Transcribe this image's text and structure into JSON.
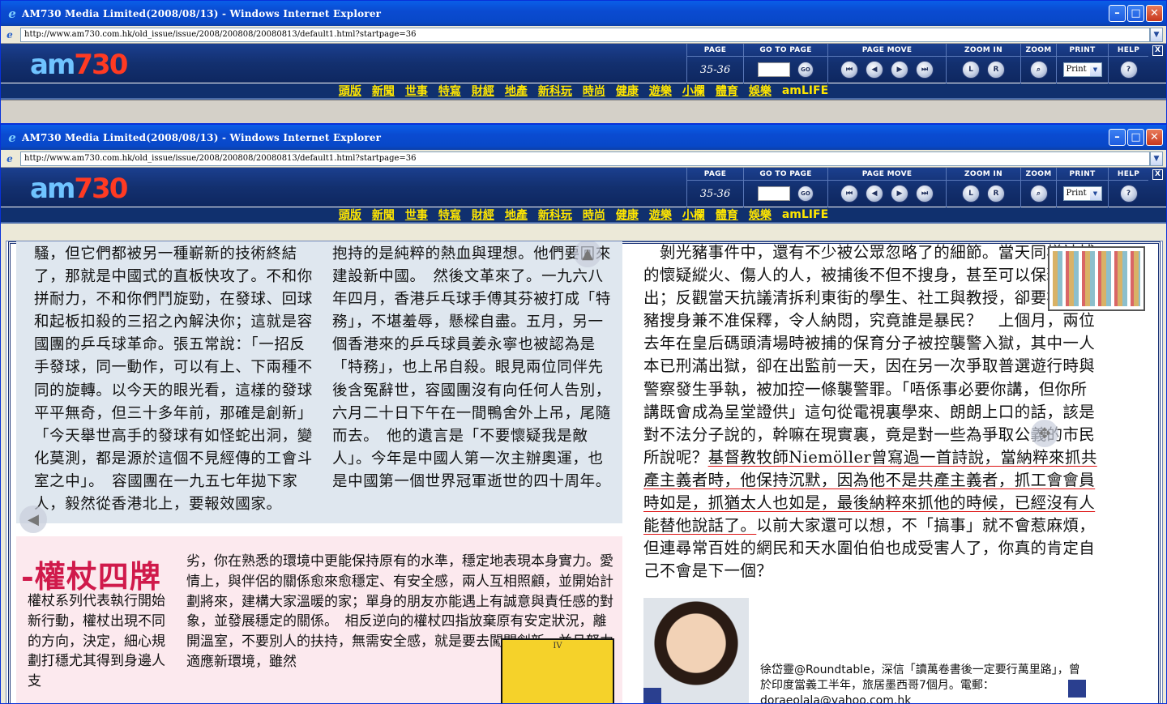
{
  "window": {
    "title": "AM730 Media Limited(2008/08/13) - Windows Internet Explorer",
    "url": "http://www.am730.com.hk/old_issue/issue/2008/200808/20080813/default1.html?startpage=36",
    "minimize": "–",
    "maximize": "□",
    "close": "✕"
  },
  "toolbar": {
    "logo_am": "am",
    "logo_num": "730",
    "page_label": "PAGE",
    "page_value": "35-36",
    "goto_label": "GO TO PAGE",
    "go_label": "GO",
    "pagemove_label": "PAGE MOVE",
    "zoomin_label": "ZOOM IN",
    "zoomin_l": "L",
    "zoomin_r": "R",
    "zoom_label": "ZOOM",
    "print_label": "PRINT",
    "print_value": "Print",
    "help_label": "HELP",
    "help_icon": "?",
    "close_x": "X"
  },
  "nav": [
    "頭版",
    "新聞",
    "世事",
    "特寫",
    "財經",
    "地產",
    "新科玩",
    "時尚",
    "健康",
    "遊樂",
    "小欄",
    "體育",
    "娛樂",
    "amLIFE"
  ],
  "article_left": {
    "col1": "騷，但它們都被另一種嶄新的技術終結了，那就是中國式的直板快攻了。不和你拼耐力，不和你們鬥旋勁，在發球、回球和起板扣殺的三招之內解決你；這就是容國團的乒乓球革命。張五常說：「一招反手發球，同一動作，可以有上、下兩種不同的旋轉。以今天的眼光看，這樣的發球平平無奇，但三十多年前，那確是創新」「今天舉世高手的發球有如怪蛇出洞，變化莫測，都是源於這個不見經傳的工會斗室之中」。　容國團在一九五七年拋下家人，毅然從香港北上，要報效國家。",
    "col2": "抱持的是純粹的熱血與理想。他們要回來建設新中國。　然後文革來了。一九六八年四月，香港乒乓球手傅其芬被打成「特務」，不堪羞辱，懸樑自盡。五月，另一個香港來的乒乓球員姜永寧也被認為是「特務」，也上吊自殺。眼見兩位同伴先後含冤辭世，容國團沒有向任何人告別，六月二十日下午在一間鴨舍外上吊，尾隨而去。　他的遺言是「不要懷疑我是敵人」。今年是中國人第一次主辦奧運，也是中國第一個世界冠軍逝世的四十周年。"
  },
  "horoscope": {
    "title": "-權杖四牌",
    "left": "權杖系列代表執行開始新行動，權杖出現不同的方向，決定，細心規劃打穩尤其得到身邊人支",
    "right": "劣，你在熟悉的環境中更能保持原有的水準，穩定地表現本身實力。愛情上，與伴侶的關係愈來愈穩定、有安全感，兩人互相照顧，並開始計劃將來，建構大家溫暖的家；單身的朋友亦能遇上有誠意與責任感的對象，並發展穩定的關係。　相反逆向的權杖四指放棄原有安定狀況，離開溫室，不要別人的扶持，無需安全感，就是要去闖關創新，並且努力適應新環境，雖然",
    "card_num": "IV"
  },
  "article_right": {
    "text_a": "　剝光豬事件中，還有不少被公眾忽略了的細節。當天同樣被捕的懷疑縱火、傷人的人，被捕後不但不搜身，甚至可以保釋外出；反觀當天抗議清拆利東街的學生、社工與教授，卻要被剝光豬搜身兼不准保釋，令人納悶，究竟誰是暴民？　上個月，兩位去年在皇后碼頭清場時被捕的保育分子被控襲警入獄，其中一人本已刑滿出獄，卻在出監前一天，因在另一次爭取普選遊行時與警察發生爭執，被加控一條襲警罪。「唔係事必要你講，但你所講既會成為呈堂證供」這句從電視裏學來、朗朗上口的話，該是對不法分子說的，幹嘛在現實裏，竟是對一些為爭取公義的市民所說呢？",
    "quote": "基督教牧師Niemöller曾寫過一首詩說，當納粹來抓共產主義者時，他保持沉默，因為他不是共產主義者，抓工會會員時如是，抓猶太人也如是，最後納粹來抓他的時候，已經沒有人能替他說話了。",
    "text_b": "以前大家還可以想，不「搞事」就不會惹麻煩，但連尋常百姓的網民和天水圍伯伯也成受害人了，你真的肯定自己不會是下一個？",
    "author_bio": "徐岱靈@Roundtable，深信「讀萬卷書後一定要行萬里路」，曾於印度當義工半年，旅居墨西哥7個月。電郵：doraeolala@yahoo.com.hk"
  }
}
